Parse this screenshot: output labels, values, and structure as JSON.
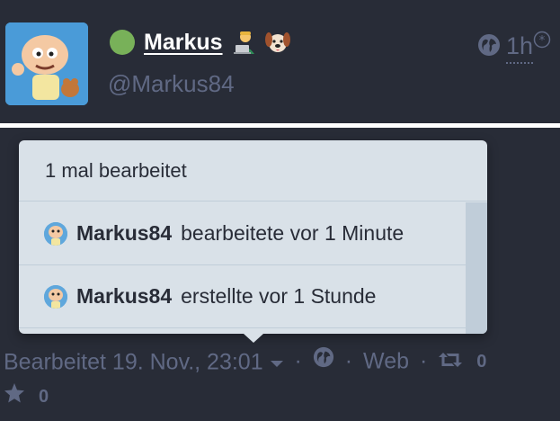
{
  "status": {
    "display_name": "Markus",
    "display_name_emojis": [
      "technologist-emoji",
      "dog-face-emoji"
    ],
    "handle": "@Markus84",
    "relative_time": "1h",
    "visibility_icon": "globe-icon",
    "online_indicator_color": "#78b159"
  },
  "edit_history": {
    "header": "1 mal bearbeitet",
    "items": [
      {
        "user": "Markus84",
        "action": "bearbeitete vor 1 Minute"
      },
      {
        "user": "Markus84",
        "action": "erstellte vor 1 Stunde"
      }
    ]
  },
  "details": {
    "edited_label": "Bearbeitet 19. Nov., 23:01",
    "separator": "·",
    "application": "Web",
    "reblog_count": "0",
    "favourite_count": "0"
  },
  "colors": {
    "background": "#282c37",
    "muted_text": "#606984",
    "dropdown_bg": "#d9e1e8"
  }
}
